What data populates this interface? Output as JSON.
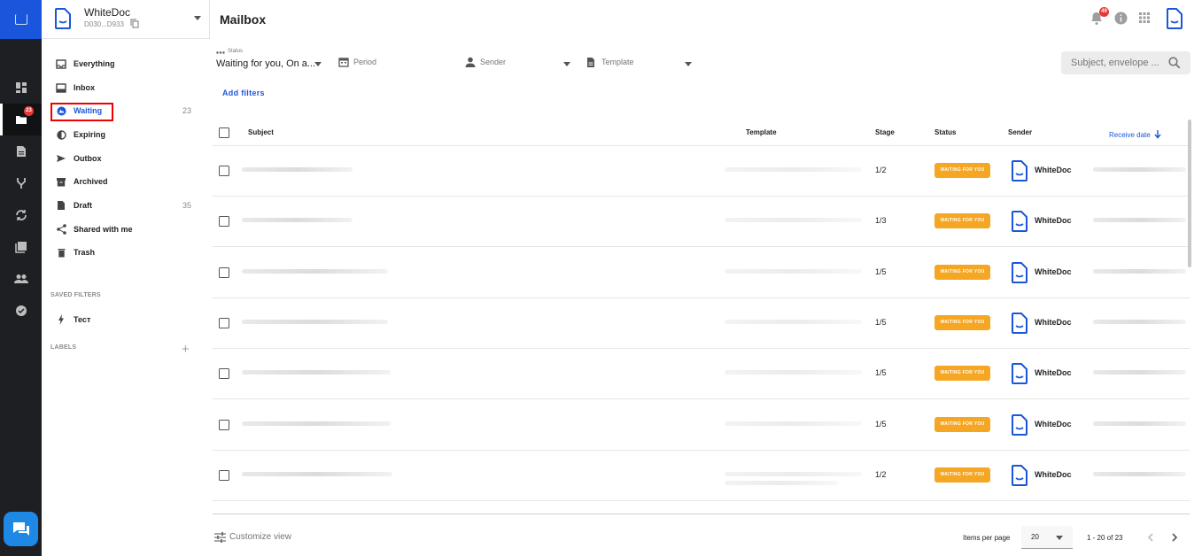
{
  "org": {
    "name": "WhiteDoc",
    "id": "D030...D933"
  },
  "header": {
    "title": "Mailbox",
    "notifications_count": "49"
  },
  "rail": {
    "folder_badge": "23"
  },
  "nav": {
    "items": [
      {
        "label": "Everything",
        "count": ""
      },
      {
        "label": "Inbox",
        "count": ""
      },
      {
        "label": "Waiting",
        "count": "23"
      },
      {
        "label": "Expiring",
        "count": ""
      },
      {
        "label": "Outbox",
        "count": ""
      },
      {
        "label": "Archived",
        "count": ""
      },
      {
        "label": "Draft",
        "count": "35"
      },
      {
        "label": "Shared with me",
        "count": ""
      },
      {
        "label": "Trash",
        "count": ""
      }
    ],
    "saved_filters_heading": "SAVED FILTERS",
    "saved_filters": [
      {
        "label": "Тест"
      }
    ],
    "labels_heading": "LABELS"
  },
  "filters": {
    "status_label": "Status",
    "status_value": "Waiting for you, On a...",
    "period_label": "Period",
    "sender_label": "Sender",
    "template_label": "Template",
    "search_placeholder": "Subject, envelope ...",
    "add_filters": "Add filters"
  },
  "table": {
    "columns": {
      "subject": "Subject",
      "template": "Template",
      "stage": "Stage",
      "status": "Status",
      "sender": "Sender",
      "receive_date": "Receive date"
    },
    "rows": [
      {
        "stage": "1/2",
        "status": "WAITING FOR YOU",
        "sender": "WhiteDoc"
      },
      {
        "stage": "1/3",
        "status": "WAITING FOR YOU",
        "sender": "WhiteDoc"
      },
      {
        "stage": "1/5",
        "status": "WAITING FOR YOU",
        "sender": "WhiteDoc"
      },
      {
        "stage": "1/5",
        "status": "WAITING FOR YOU",
        "sender": "WhiteDoc"
      },
      {
        "stage": "1/5",
        "status": "WAITING FOR YOU",
        "sender": "WhiteDoc"
      },
      {
        "stage": "1/5",
        "status": "WAITING FOR YOU",
        "sender": "WhiteDoc"
      },
      {
        "stage": "1/2",
        "status": "WAITING FOR YOU",
        "sender": "WhiteDoc"
      }
    ]
  },
  "footer": {
    "customize_view": "Customize view",
    "items_per_page_label": "Items per page",
    "items_per_page": "20",
    "range": "1 - 20 of 23"
  },
  "colors": {
    "accent": "#1a56db",
    "status_badge": "#f5a623",
    "rail": "#1d1f23",
    "alert": "#e53935"
  }
}
